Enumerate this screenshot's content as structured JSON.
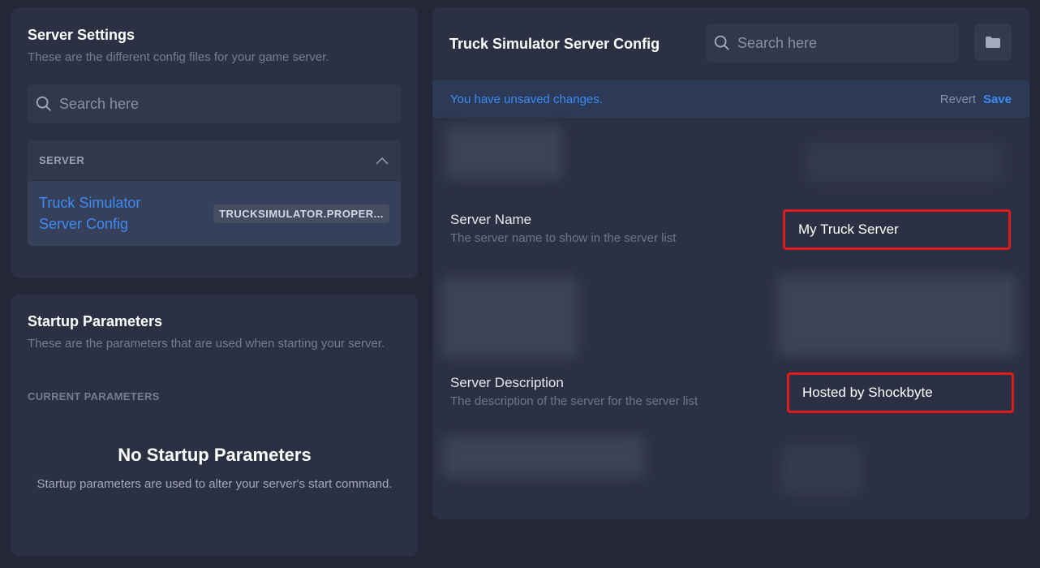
{
  "server_settings": {
    "title": "Server Settings",
    "subtitle": "These are the different config files for your game server.",
    "search_placeholder": "Search here",
    "group": {
      "label": "SERVER",
      "items": [
        {
          "label": "Truck Simulator Server Config",
          "file": "TRUCKSIMULATOR.PROPER..."
        }
      ]
    }
  },
  "startup": {
    "title": "Startup Parameters",
    "subtitle": "These are the parameters that are used when starting your server.",
    "current_label": "CURRENT PARAMETERS",
    "empty_title": "No Startup Parameters",
    "empty_desc": "Startup parameters are used to alter your server's start command."
  },
  "config": {
    "title": "Truck Simulator Server Config",
    "search_placeholder": "Search here",
    "unsaved_message": "You have unsaved changes.",
    "revert_label": "Revert",
    "save_label": "Save",
    "settings": [
      {
        "label": "Server Name",
        "description": "The server name to show in the server list",
        "value": "My Truck Server"
      },
      {
        "label": "Server Description",
        "description": "The description of the server for the server list",
        "value": "Hosted by Shockbyte"
      }
    ]
  },
  "colors": {
    "accent": "#3d8bf2",
    "highlight": "#e01b1b",
    "background": "#232737",
    "panel": "#2b3042"
  },
  "icons": [
    "search-icon",
    "chevron-up-icon",
    "folder-icon"
  ]
}
